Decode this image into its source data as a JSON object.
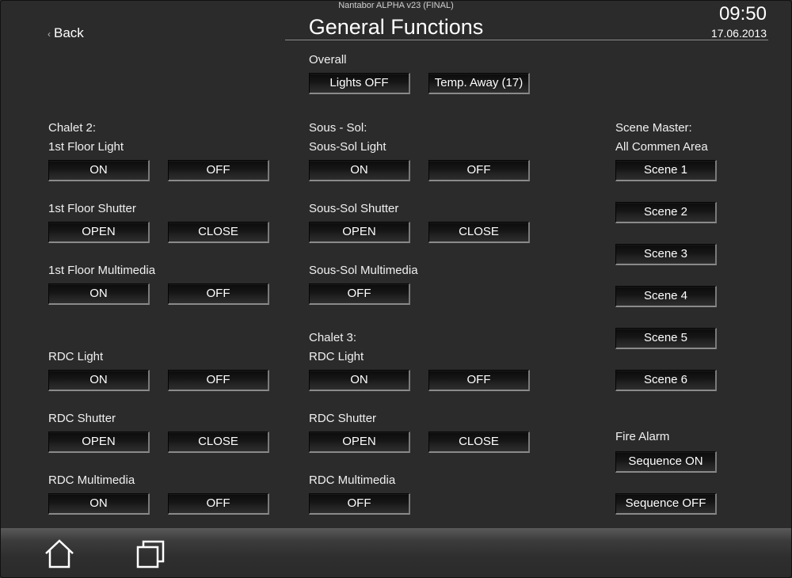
{
  "app_title": "Nantabor ALPHA v23 (FINAL)",
  "header": {
    "back_label": "Back",
    "back_chevron": "‹",
    "title": "General Functions",
    "time": "09:50",
    "date": "17.06.2013"
  },
  "overall": {
    "heading": "Overall",
    "lights_off": "Lights OFF",
    "temp_away": "Temp. Away (17)"
  },
  "chalet2": {
    "heading": "Chalet 2:",
    "floor_light": {
      "label": "1st Floor Light",
      "on": "ON",
      "off": "OFF"
    },
    "floor_shutter": {
      "label": "1st Floor Shutter",
      "open": "OPEN",
      "close": "CLOSE"
    },
    "floor_multimedia": {
      "label": "1st Floor Multimedia",
      "on": "ON",
      "off": "OFF"
    },
    "rdc_light": {
      "label": "RDC Light",
      "on": "ON",
      "off": "OFF"
    },
    "rdc_shutter": {
      "label": "RDC Shutter",
      "open": "OPEN",
      "close": "CLOSE"
    },
    "rdc_multimedia": {
      "label": "RDC Multimedia",
      "on": "ON",
      "off": "OFF"
    }
  },
  "sous_sol": {
    "heading": "Sous - Sol:",
    "light": {
      "label": "Sous-Sol Light",
      "on": "ON",
      "off": "OFF"
    },
    "shutter": {
      "label": "Sous-Sol Shutter",
      "open": "OPEN",
      "close": "CLOSE"
    },
    "multimedia": {
      "label": "Sous-Sol Multimedia",
      "off": "OFF"
    }
  },
  "chalet3": {
    "heading": "Chalet 3:",
    "rdc_light": {
      "label": "RDC Light",
      "on": "ON",
      "off": "OFF"
    },
    "rdc_shutter": {
      "label": "RDC Shutter",
      "open": "OPEN",
      "close": "CLOSE"
    },
    "rdc_multimedia": {
      "label": "RDC Multimedia",
      "off": "OFF"
    }
  },
  "scene_master": {
    "heading": "Scene Master:",
    "subheading": "All Commen Area",
    "scenes": [
      "Scene 1",
      "Scene 2",
      "Scene 3",
      "Scene 4",
      "Scene 5",
      "Scene 6"
    ]
  },
  "fire_alarm": {
    "heading": "Fire Alarm",
    "seq_on": "Sequence ON",
    "seq_off": "Sequence OFF"
  },
  "bottom_nav": {
    "home_icon": "home-icon",
    "windows_icon": "multitask-icon"
  }
}
